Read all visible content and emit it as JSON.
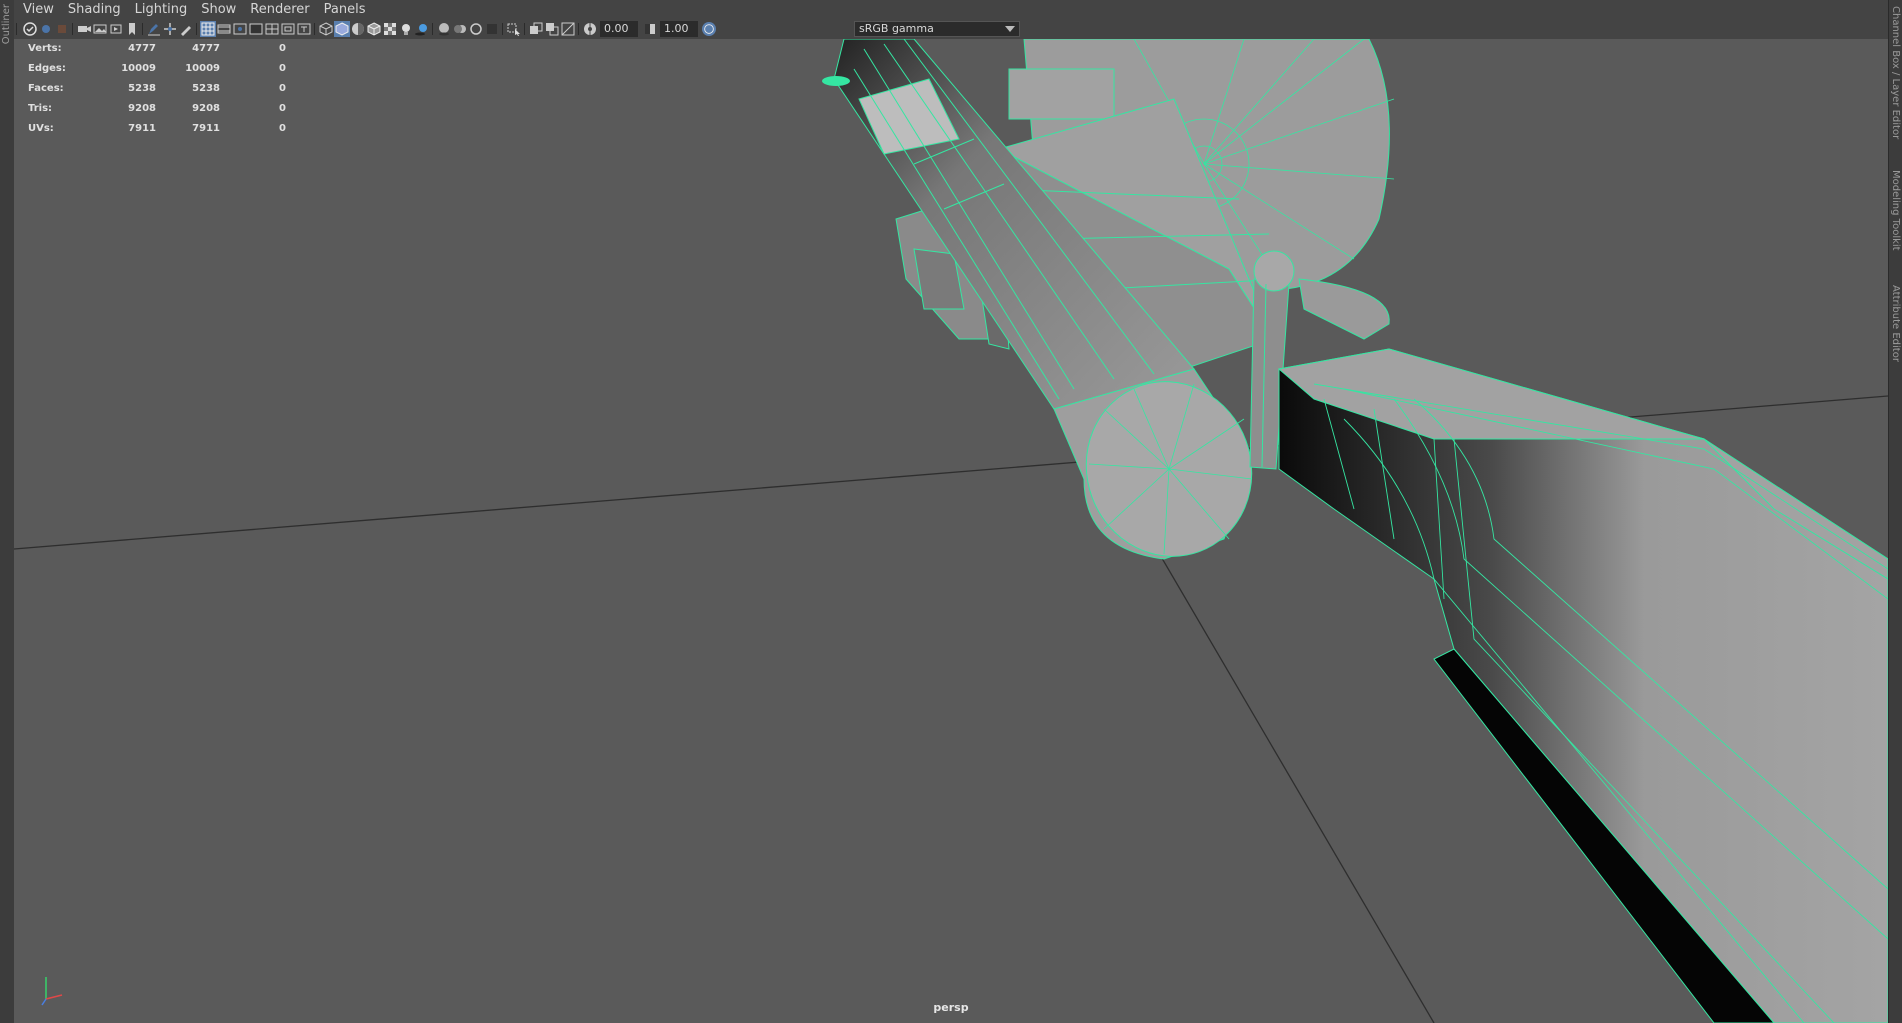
{
  "side_panels": {
    "left_label": "Outliner",
    "right_tabs": [
      "Channel Box / Layer Editor",
      "Modeling Toolkit",
      "Attribute Editor"
    ]
  },
  "menubar": {
    "items": [
      "View",
      "Shading",
      "Lighting",
      "Show",
      "Renderer",
      "Panels"
    ]
  },
  "toolbar": {
    "exposure": "0.00",
    "gamma": "1.00",
    "color_space": "sRGB gamma",
    "icons": [
      "select-camera-icon",
      "camera-attributes-icon",
      "bookmark-icon",
      "image-plane-icon",
      "grid-icon",
      "film-gate-icon",
      "resolution-gate-icon",
      "gate-mask-icon",
      "field-chart-icon",
      "safe-action-icon",
      "safe-title-icon",
      "wireframe-icon",
      "smooth-shade-icon",
      "default-material-icon",
      "wireframe-on-shaded-icon",
      "xray-icon",
      "use-default-lights-icon",
      "shadows-icon",
      "screen-space-ao-icon",
      "motion-blur-icon",
      "anti-aliasing-icon",
      "depth-of-field-icon",
      "isolate-select-icon",
      "xray-joints-icon",
      "xray-active-components-icon",
      "exposure-icon",
      "gamma-icon",
      "color-management-icon"
    ]
  },
  "hud": {
    "rows": [
      {
        "label": "Verts:",
        "v1": "4777",
        "v2": "4777",
        "v3": "0"
      },
      {
        "label": "Edges:",
        "v1": "10009",
        "v2": "10009",
        "v3": "0"
      },
      {
        "label": "Faces:",
        "v1": "5238",
        "v2": "5238",
        "v3": "0"
      },
      {
        "label": "Tris:",
        "v1": "9208",
        "v2": "9208",
        "v3": "0"
      },
      {
        "label": "UVs:",
        "v1": "7911",
        "v2": "7911",
        "v3": "0"
      }
    ]
  },
  "viewport": {
    "camera": "persp",
    "background": "#5a5a5a",
    "wire_color": "#33e6a0",
    "mesh_color": "#9a9a9a"
  }
}
